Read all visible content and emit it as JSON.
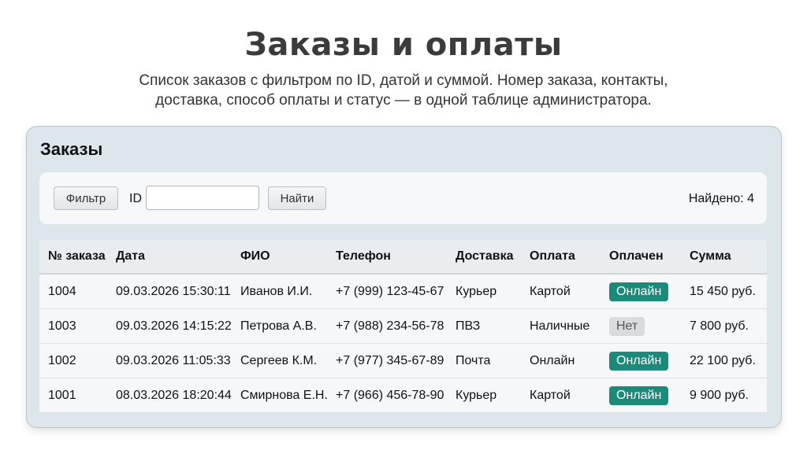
{
  "header": {
    "title": "Заказы и оплаты",
    "subtitle_line1": "Список заказов с фильтром по ID, датой и суммой. Номер заказа, контакты,",
    "subtitle_line2": "доставка, способ оплаты и статус — в одной таблице администратора."
  },
  "panel": {
    "title": "Заказы"
  },
  "filter": {
    "filter_button": "Фильтр",
    "id_label": "ID",
    "id_value": "",
    "find_button": "Найти",
    "found_text": "Найдено: 4"
  },
  "table": {
    "columns": [
      "№ заказа",
      "Дата",
      "ФИО",
      "Телефон",
      "Доставка",
      "Оплата",
      "Оплачен",
      "Сумма"
    ],
    "rows": [
      {
        "id": "1004",
        "date": "09.03.2026 15:30:11",
        "name": "Иванов И.И.",
        "phone": "+7 (999) 123-45-67",
        "delivery": "Курьер",
        "payment": "Картой",
        "paid": "Онлайн",
        "paid_status": "paid",
        "sum": "15 450 руб."
      },
      {
        "id": "1003",
        "date": "09.03.2026 14:15:22",
        "name": "Петрова А.В.",
        "phone": "+7 (988) 234-56-78",
        "delivery": "ПВЗ",
        "payment": "Наличные",
        "paid": "Нет",
        "paid_status": "unpaid",
        "sum": "7 800 руб."
      },
      {
        "id": "1002",
        "date": "09.03.2026 11:05:33",
        "name": "Сергеев К.М.",
        "phone": "+7 (977) 345-67-89",
        "delivery": "Почта",
        "payment": "Онлайн",
        "paid": "Онлайн",
        "paid_status": "paid",
        "sum": "22 100 руб."
      },
      {
        "id": "1001",
        "date": "08.03.2026 18:20:44",
        "name": "Смирнова Е.Н.",
        "phone": "+7 (966) 456-78-90",
        "delivery": "Курьер",
        "payment": "Картой",
        "paid": "Онлайн",
        "paid_status": "paid",
        "sum": "9 900 руб."
      }
    ]
  },
  "colors": {
    "paid_badge": "#1b8a7a",
    "unpaid_badge": "#d9dcde",
    "panel_bg": "#dde6ea"
  }
}
